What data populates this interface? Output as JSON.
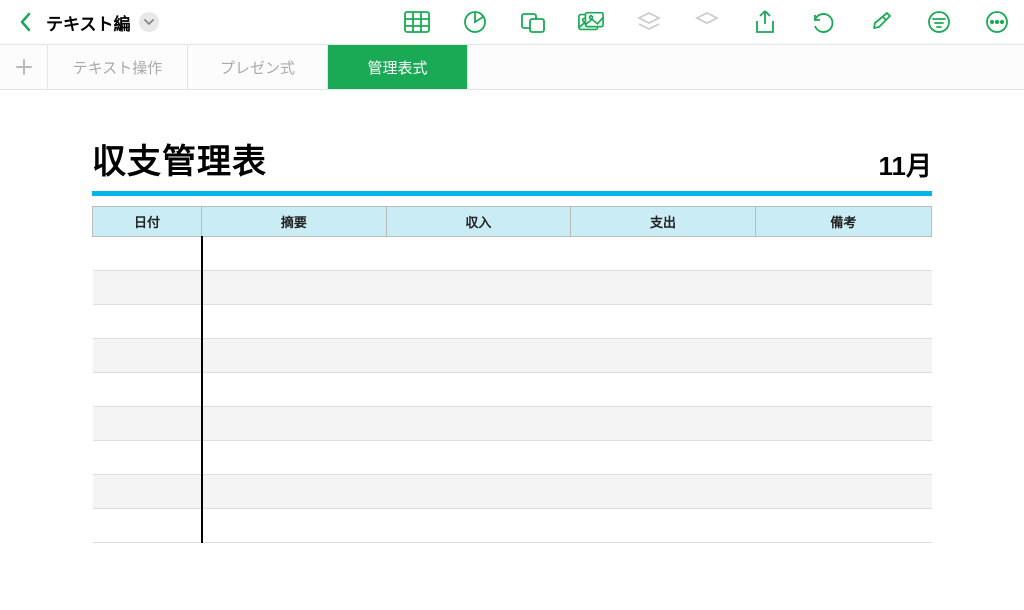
{
  "topbar": {
    "doc_title": "テキスト編",
    "icons": {
      "back": "back-icon",
      "dropdown": "chevron-down-icon",
      "table": "table-icon",
      "chart": "chart-icon",
      "shape": "shape-icon",
      "image": "image-icon",
      "layer_forward": "layer-forward-icon",
      "layer_back": "layer-back-icon",
      "share": "share-icon",
      "undo": "undo-icon",
      "brush": "brush-icon",
      "filter": "filter-icon",
      "more": "more-icon"
    }
  },
  "tabs": [
    {
      "label": "テキスト操作",
      "active": false
    },
    {
      "label": "プレゼン式",
      "active": false
    },
    {
      "label": "管理表式",
      "active": true
    }
  ],
  "sheet": {
    "title": "収支管理表",
    "month": "11月",
    "columns": [
      "日付",
      "摘要",
      "収入",
      "支出",
      "備考"
    ],
    "row_count": 9
  },
  "colors": {
    "accent_green": "#1aaa55",
    "accent_cyan": "#00b7eb",
    "header_cell": "#c9ecf5"
  }
}
